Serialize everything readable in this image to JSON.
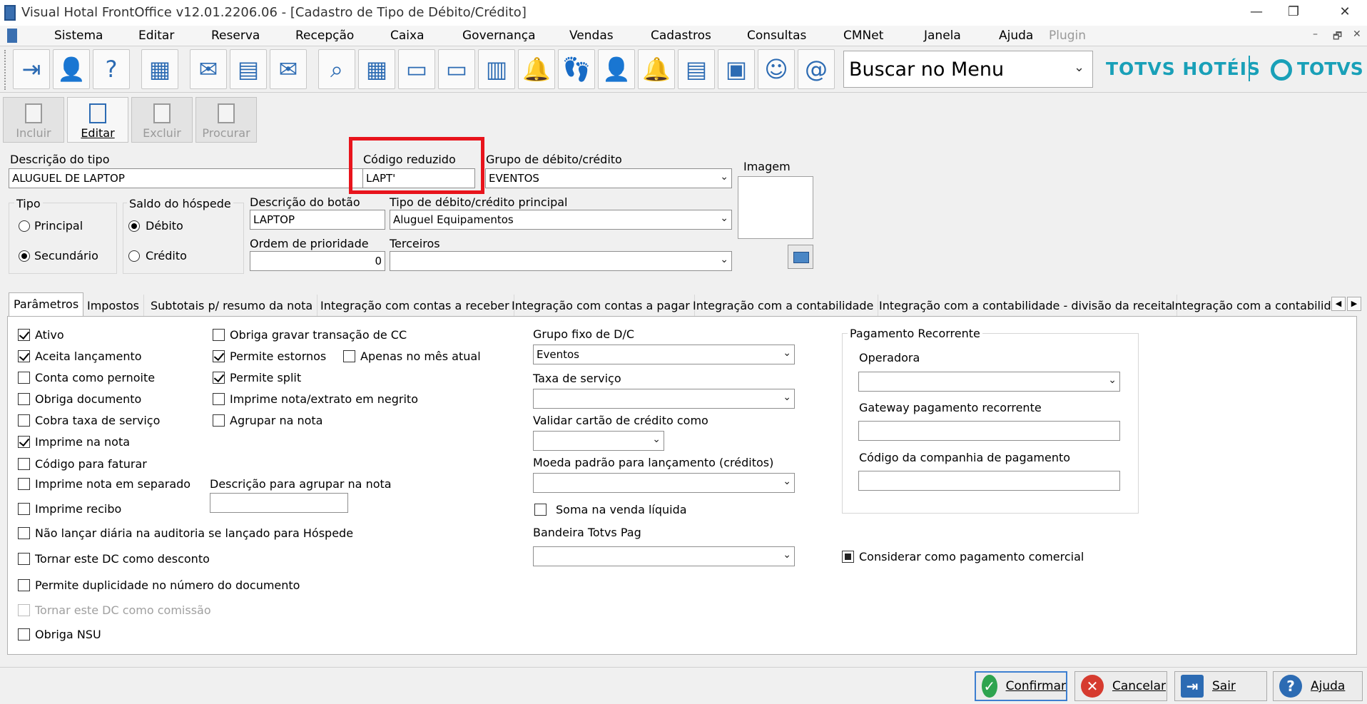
{
  "window": {
    "title": "Visual Hotal FrontOffice v12.01.2206.06 - [Cadastro de Tipo de Débito/Crédito]",
    "minimize": "—",
    "restore": "❐",
    "close": "✕"
  },
  "menu": {
    "items": [
      "Sistema",
      "Editar",
      "Reserva",
      "Recepção",
      "Caixa",
      "Governança",
      "Vendas",
      "Cadastros",
      "Consultas",
      "CMNet",
      "Janela",
      "Ajuda"
    ],
    "plugin": "Plugin",
    "mdi_minimize": "–",
    "mdi_restore": "🗗",
    "mdi_close": "✕"
  },
  "toolbar": {
    "icons": [
      "exit-icon",
      "user-key-icon",
      "help-icon",
      "org-chart-icon",
      "mail-icon",
      "spreadsheet-edit-icon",
      "mail-send-icon",
      "search-icon",
      "calendar-icon",
      "guest-card-icon",
      "guest-card-2-icon",
      "report-user-icon",
      "bell-icon",
      "footprints-icon",
      "add-user-icon",
      "bell-user-icon",
      "invoice-icon",
      "cash-register-icon",
      "maid-icon",
      "email-at-icon"
    ],
    "search_value": "Buscar no Menu",
    "brand_left": "TOTVS HOTÉIS",
    "brand_right": "TOTVS"
  },
  "actions": {
    "incluir": "Incluir",
    "editar": "Editar",
    "excluir": "Excluir",
    "procurar": "Procurar"
  },
  "form": {
    "descricao_tipo_label": "Descrição do tipo",
    "descricao_tipo_value": "ALUGUEL DE LAPTOP",
    "codigo_reduzido_label": "Código reduzido",
    "codigo_reduzido_value": "LAPT'",
    "grupo_label": "Grupo de débito/crédito",
    "grupo_value": "EVENTOS",
    "imagem_label": "Imagem",
    "tipo_label": "Tipo",
    "tipo_principal": "Principal",
    "tipo_secundario": "Secundário",
    "saldo_label": "Saldo do hóspede",
    "saldo_debito": "Débito",
    "saldo_credito": "Crédito",
    "descricao_botao_label": "Descrição do botão",
    "descricao_botao_value": "LAPTOP",
    "tipo_principal_label": "Tipo de débito/crédito principal",
    "tipo_principal_value": "Aluguel Equipamentos",
    "ordem_label": "Ordem de prioridade",
    "ordem_value": "0",
    "terceiros_label": "Terceiros",
    "terceiros_value": ""
  },
  "tabs": [
    "Parâmetros",
    "Impostos",
    "Subtotais p/ resumo da nota",
    "Integração com contas a receber",
    "Integração com contas a pagar",
    "Integração com a contabilidade",
    "Integração com a contabilidade - divisão da receita",
    "Integração com a contabilida"
  ],
  "tab_arrows": {
    "left": "◀",
    "right": "▶"
  },
  "params": {
    "col1": [
      {
        "label": "Ativo",
        "checked": true
      },
      {
        "label": "Aceita lançamento",
        "checked": true
      },
      {
        "label": "Conta como pernoite",
        "checked": false
      },
      {
        "label": "Obriga documento",
        "checked": false
      },
      {
        "label": "Cobra taxa de serviço",
        "checked": false
      },
      {
        "label": "Imprime na nota",
        "checked": true
      },
      {
        "label": "Código para faturar",
        "checked": false
      },
      {
        "label": "Imprime nota em separado",
        "checked": false
      },
      {
        "label": "Imprime recibo",
        "checked": false
      },
      {
        "label": "Não lançar diária na auditoria se lançado para Hóspede",
        "checked": false
      },
      {
        "label": "Tornar este DC como desconto",
        "checked": false
      },
      {
        "label": "Permite duplicidade no número do documento",
        "checked": false
      },
      {
        "label": "Tornar este DC como comissão",
        "checked": false,
        "disabled": true
      },
      {
        "label": "Obriga NSU",
        "checked": false
      }
    ],
    "col2": [
      {
        "label": "Obriga gravar transação de CC",
        "checked": false
      },
      {
        "label": "Permite estornos",
        "checked": true
      },
      {
        "label": "Permite split",
        "checked": true
      },
      {
        "label": "Imprime nota/extrato em negrito",
        "checked": false
      },
      {
        "label": "Agrupar na nota",
        "checked": false
      }
    ],
    "apenas_mes": {
      "label": "Apenas no mês atual",
      "checked": false
    },
    "descricao_agrupar_label": "Descrição para agrupar na nota",
    "descricao_agrupar_value": "",
    "grupo_fixo_label": "Grupo fixo de D/C",
    "grupo_fixo_value": "Eventos",
    "taxa_servico_label": "Taxa de serviço",
    "taxa_servico_value": "",
    "validar_cartao_label": "Validar cartão de crédito como",
    "validar_cartao_value": "",
    "moeda_label": "Moeda padrão para lançamento (créditos)",
    "moeda_value": "",
    "soma_venda": {
      "label": "Soma na venda líquida",
      "checked": false
    },
    "bandeira_label": "Bandeira Totvs Pag",
    "bandeira_value": "",
    "pagamento_recorrente_label": "Pagamento Recorrente",
    "operadora_label": "Operadora",
    "operadora_value": "",
    "gateway_label": "Gateway pagamento recorrente",
    "gateway_value": "",
    "codigo_companhia_label": "Código da companhia de pagamento",
    "codigo_companhia_value": "",
    "considerar_pagamento": {
      "label": "Considerar como pagamento comercial",
      "checked": true
    }
  },
  "buttons": {
    "confirmar": "Confirmar",
    "cancelar": "Cancelar",
    "sair": "Sair",
    "ajuda": "Ajuda"
  },
  "colors": {
    "brand": "#19a0b8",
    "highlight": "#e8141c",
    "confirm": "#2ea44f",
    "cancel": "#d63b2f",
    "accent": "#2c6bb3"
  }
}
